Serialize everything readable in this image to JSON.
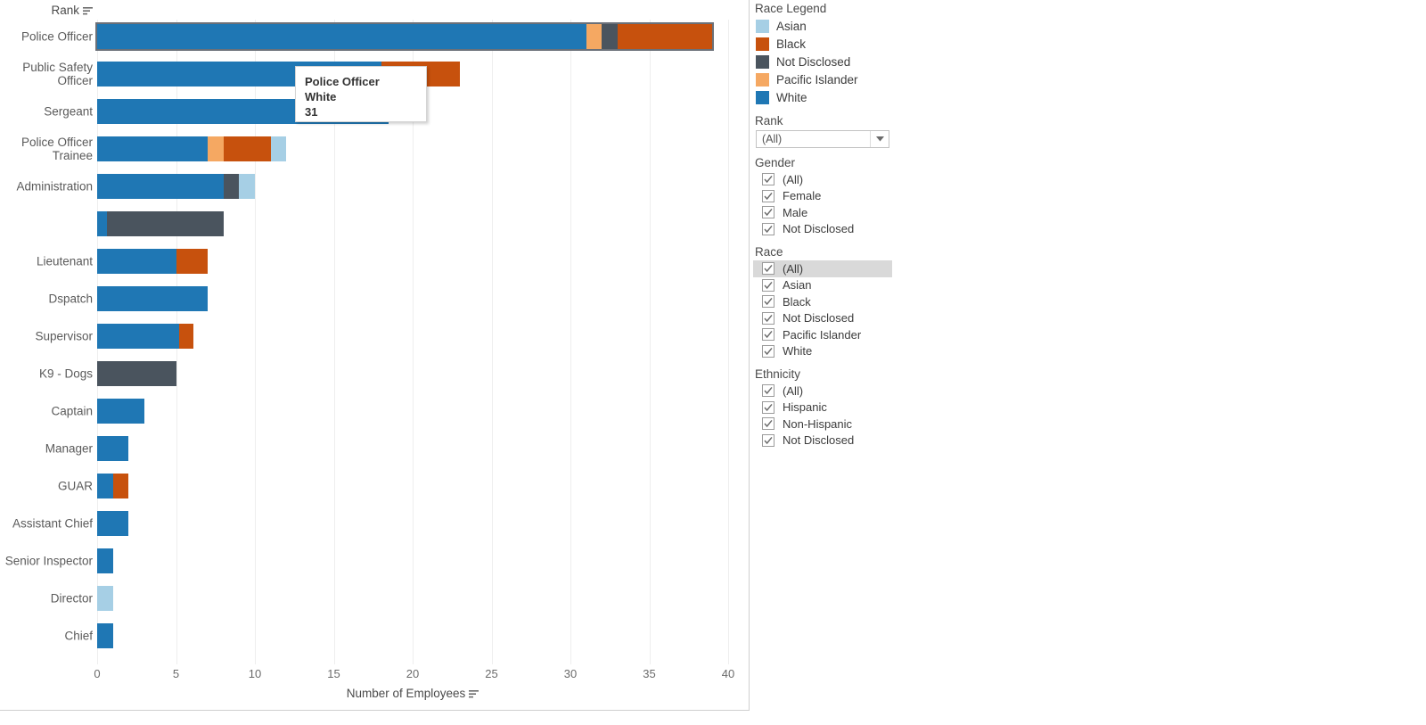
{
  "chart_data": {
    "type": "bar",
    "orientation": "horizontal",
    "stacked": true,
    "title": "",
    "xlabel": "Number of Employees",
    "ylabel": "Rank",
    "xlim": [
      0,
      40
    ],
    "xticks": [
      0,
      5,
      10,
      15,
      20,
      25,
      30,
      35,
      40
    ],
    "grid": true,
    "legend_position": "right",
    "series_names": [
      "Asian",
      "Black",
      "Not Disclosed",
      "Pacific Islander",
      "White"
    ],
    "series_colors": {
      "Asian": "#a6cfe5",
      "Black": "#c7510d",
      "Not Disclosed": "#4a545e",
      "Pacific Islander": "#f5a862",
      "White": "#1f77b4"
    },
    "categories": [
      "Police Officer",
      "Public Safety Officer",
      "Sergeant",
      "Police Officer Trainee",
      "Administration",
      "",
      "Lieutenant",
      "Dspatch",
      "Supervisor",
      "K9 - Dogs",
      "Captain",
      "Manager",
      "GUAR",
      "Assistant Chief",
      "Senior Inspector",
      "Director",
      "Chief"
    ],
    "rows": [
      {
        "category": "Police Officer",
        "label_lines": "Police Officer",
        "selected": true,
        "segments": [
          {
            "name": "White",
            "value": 31
          },
          {
            "name": "Pacific Islander",
            "value": 1
          },
          {
            "name": "Not Disclosed",
            "value": 1
          },
          {
            "name": "Black",
            "value": 6
          }
        ]
      },
      {
        "category": "Public Safety Officer",
        "label_lines": "Public Safety\nOfficer",
        "selected": false,
        "segments": [
          {
            "name": "White",
            "value": 18
          },
          {
            "name": "Black",
            "value": 5
          }
        ]
      },
      {
        "category": "Sergeant",
        "label_lines": "Sergeant",
        "selected": false,
        "segments": [
          {
            "name": "White",
            "value": 18.5
          }
        ]
      },
      {
        "category": "Police Officer Trainee",
        "label_lines": "Police Officer\nTrainee",
        "selected": false,
        "segments": [
          {
            "name": "White",
            "value": 7
          },
          {
            "name": "Pacific Islander",
            "value": 1
          },
          {
            "name": "Black",
            "value": 3
          },
          {
            "name": "Asian",
            "value": 1
          }
        ]
      },
      {
        "category": "Administration",
        "label_lines": "Administration",
        "selected": false,
        "segments": [
          {
            "name": "White",
            "value": 8
          },
          {
            "name": "Not Disclosed",
            "value": 1
          },
          {
            "name": "Asian",
            "value": 1
          }
        ]
      },
      {
        "category": "",
        "label_lines": "",
        "selected": false,
        "segments": [
          {
            "name": "White",
            "value": 0.6
          },
          {
            "name": "Not Disclosed",
            "value": 7.4
          }
        ]
      },
      {
        "category": "Lieutenant",
        "label_lines": "Lieutenant",
        "selected": false,
        "segments": [
          {
            "name": "White",
            "value": 5
          },
          {
            "name": "Black",
            "value": 2
          }
        ]
      },
      {
        "category": "Dspatch",
        "label_lines": "Dspatch",
        "selected": false,
        "segments": [
          {
            "name": "White",
            "value": 7
          }
        ]
      },
      {
        "category": "Supervisor",
        "label_lines": "Supervisor",
        "selected": false,
        "segments": [
          {
            "name": "White",
            "value": 5.2
          },
          {
            "name": "Black",
            "value": 0.9
          }
        ]
      },
      {
        "category": "K9 - Dogs",
        "label_lines": "K9 - Dogs",
        "selected": false,
        "segments": [
          {
            "name": "Not Disclosed",
            "value": 5
          }
        ]
      },
      {
        "category": "Captain",
        "label_lines": "Captain",
        "selected": false,
        "segments": [
          {
            "name": "White",
            "value": 3
          }
        ]
      },
      {
        "category": "Manager",
        "label_lines": "Manager",
        "selected": false,
        "segments": [
          {
            "name": "White",
            "value": 2
          }
        ]
      },
      {
        "category": "GUAR",
        "label_lines": "GUAR",
        "selected": false,
        "segments": [
          {
            "name": "White",
            "value": 1
          },
          {
            "name": "Black",
            "value": 1
          }
        ]
      },
      {
        "category": "Assistant Chief",
        "label_lines": "Assistant Chief",
        "selected": false,
        "segments": [
          {
            "name": "White",
            "value": 2
          }
        ]
      },
      {
        "category": "Senior Inspector",
        "label_lines": "Senior Inspector",
        "selected": false,
        "segments": [
          {
            "name": "White",
            "value": 1
          }
        ]
      },
      {
        "category": "Director",
        "label_lines": "Director",
        "selected": false,
        "segments": [
          {
            "name": "Asian",
            "value": 1
          }
        ]
      },
      {
        "category": "Chief",
        "label_lines": "Chief",
        "selected": false,
        "segments": [
          {
            "name": "White",
            "value": 1
          }
        ]
      }
    ]
  },
  "chart": {
    "row_header_label": "Rank",
    "axis_title": "Number of Employees"
  },
  "tooltip": {
    "line1": "Police Officer",
    "line2": "White",
    "line3": "31"
  },
  "sidebar": {
    "legend": {
      "title": "Race Legend",
      "items": [
        {
          "label": "Asian",
          "color": "#a6cfe5"
        },
        {
          "label": "Black",
          "color": "#c7510d"
        },
        {
          "label": "Not Disclosed",
          "color": "#4a545e"
        },
        {
          "label": "Pacific Islander",
          "color": "#f5a862"
        },
        {
          "label": "White",
          "color": "#1f77b4"
        }
      ]
    },
    "rank_filter": {
      "title": "Rank",
      "selected": "(All)"
    },
    "gender_filter": {
      "title": "Gender",
      "items": [
        {
          "label": "(All)",
          "checked": true,
          "highlighted": false
        },
        {
          "label": "Female",
          "checked": true,
          "highlighted": false
        },
        {
          "label": "Male",
          "checked": true,
          "highlighted": false
        },
        {
          "label": "Not Disclosed",
          "checked": true,
          "highlighted": false
        }
      ]
    },
    "race_filter": {
      "title": "Race",
      "items": [
        {
          "label": "(All)",
          "checked": true,
          "highlighted": true
        },
        {
          "label": "Asian",
          "checked": true,
          "highlighted": false
        },
        {
          "label": "Black",
          "checked": true,
          "highlighted": false
        },
        {
          "label": "Not Disclosed",
          "checked": true,
          "highlighted": false
        },
        {
          "label": "Pacific Islander",
          "checked": true,
          "highlighted": false
        },
        {
          "label": "White",
          "checked": true,
          "highlighted": false
        }
      ]
    },
    "ethnicity_filter": {
      "title": "Ethnicity",
      "items": [
        {
          "label": "(All)",
          "checked": true,
          "highlighted": false
        },
        {
          "label": "Hispanic",
          "checked": true,
          "highlighted": false
        },
        {
          "label": "Non-Hispanic",
          "checked": true,
          "highlighted": false
        },
        {
          "label": "Not Disclosed",
          "checked": true,
          "highlighted": false
        }
      ]
    }
  },
  "icons": {
    "sort": "sort-descending-icon",
    "caret": "chevron-down-icon",
    "check": "check-icon"
  }
}
